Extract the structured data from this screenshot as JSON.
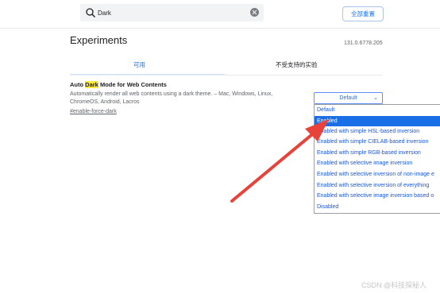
{
  "search": {
    "value": "Dark"
  },
  "header": {
    "reset_label": "全部重置"
  },
  "page": {
    "title": "Experiments",
    "version": "131.0.6778.205"
  },
  "tabs": {
    "available": "可用",
    "unavailable": "不受支持的实验"
  },
  "experiment": {
    "title_prefix": "Auto ",
    "title_highlight": "Dark",
    "title_suffix": " Mode for Web Contents",
    "description": "Automatically render all web contents using a dark theme. – Mac, Windows, Linux, ChromeOS, Android, Lacros",
    "link": "#enable-force-dark",
    "select_value": "Default"
  },
  "dropdown": {
    "options": [
      "Default",
      "Enabled",
      "Enabled with simple HSL-based inversion",
      "Enabled with simple CIELAB-based inversion",
      "Enabled with simple RGB-based inversion",
      "Enabled with selective image inversion",
      "Enabled with selective inversion of non-image e",
      "Enabled with selective inversion of everything",
      "Enabled with selective image inversion based o",
      "Disabled"
    ],
    "selected_index": 1
  },
  "colors": {
    "accent": "#1a73e8",
    "selected_bg": "#1a6ee6",
    "highlight": "#ffeb3b",
    "annotation_arrow": "#e8433b"
  },
  "icons": {
    "search": "search-icon",
    "clear": "clear-icon",
    "chevron": "chevron-down-icon"
  },
  "watermark": "CSDN @科技探秘人"
}
